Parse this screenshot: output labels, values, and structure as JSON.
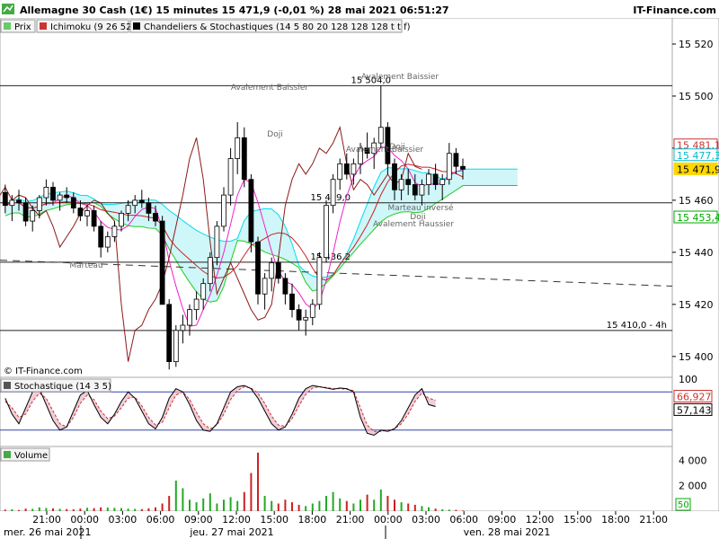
{
  "header": {
    "title": "Allemagne 30 Cash (1€) 15 minutes 15 471,9 (-0,01 %) 28 mai 2021 06:51:27",
    "brand": "IT-Finance.com"
  },
  "legend": [
    {
      "label": "Prix",
      "color": "#66cc66"
    },
    {
      "label": "Ichimoku (9 26 52)",
      "color": "#cc3333"
    },
    {
      "label": "Chandeliers & Stochastiques (14 5 80 20 128 128 128 t t f)",
      "color": "#000000"
    }
  ],
  "copyright": "© IT-Finance.com",
  "chart_data": [
    {
      "type": "candlestick",
      "ylim": [
        15392,
        15530
      ],
      "y_ticks": [
        "15 400",
        "15 420",
        "15 440",
        "15 460",
        "15 480",
        "15 500",
        "15 520"
      ],
      "price_tags": [
        {
          "value": 15481.1,
          "label": "15 481,1",
          "color": "#cc3333"
        },
        {
          "value": 15477.3,
          "label": "15 477,3",
          "color": "#00bbcc"
        },
        {
          "value": 15471.9,
          "label": "15 471,9",
          "color": "#ffd700"
        },
        {
          "value": 15453.4,
          "label": "15 453,4",
          "color": "#00aa00"
        }
      ],
      "levels": [
        {
          "value": 15504.0,
          "label": "15 504,0"
        },
        {
          "value": 15459.0,
          "label": "15 459,0"
        },
        {
          "value": 15436.2,
          "label": "15 436,2"
        },
        {
          "value": 15410.0,
          "label": "15 410,0 - 4h"
        }
      ],
      "annotations": [
        "Avalement Baissier",
        "Avalement Baissier",
        "Doji",
        "Avalement Baissier",
        "Doji",
        "Marteau",
        "Marteau inversé",
        "Avalement Haussier",
        "Doji"
      ],
      "candles_ohlc": [
        [
          15463,
          15466,
          15455,
          15458
        ],
        [
          15458,
          15462,
          15452,
          15460
        ],
        [
          15460,
          15464,
          15456,
          15459
        ],
        [
          15459,
          15461,
          15450,
          15452
        ],
        [
          15452,
          15458,
          15448,
          15456
        ],
        [
          15456,
          15462,
          15453,
          15461
        ],
        [
          15461,
          15468,
          15458,
          15465
        ],
        [
          15465,
          15467,
          15458,
          15460
        ],
        [
          15460,
          15463,
          15456,
          15462
        ],
        [
          15462,
          15465,
          15459,
          15461
        ],
        [
          15461,
          15463,
          15455,
          15457
        ],
        [
          15457,
          15460,
          15452,
          15454
        ],
        [
          15454,
          15458,
          15450,
          15456
        ],
        [
          15456,
          15458,
          15448,
          15450
        ],
        [
          15450,
          15452,
          15438,
          15442
        ],
        [
          15442,
          15448,
          15440,
          15446
        ],
        [
          15446,
          15452,
          15444,
          15450
        ],
        [
          15450,
          15456,
          15448,
          15455
        ],
        [
          15455,
          15460,
          15452,
          15458
        ],
        [
          15458,
          15462,
          15455,
          15460
        ],
        [
          15460,
          15464,
          15457,
          15459
        ],
        [
          15459,
          15461,
          15452,
          15455
        ],
        [
          15455,
          15458,
          15450,
          15452
        ],
        [
          15452,
          15454,
          15430,
          15420
        ],
        [
          15420,
          15422,
          15395,
          15398
        ],
        [
          15398,
          15412,
          15396,
          15410
        ],
        [
          15410,
          15416,
          15405,
          15412
        ],
        [
          15412,
          15420,
          15408,
          15418
        ],
        [
          15418,
          15425,
          15414,
          15422
        ],
        [
          15422,
          15430,
          15418,
          15428
        ],
        [
          15428,
          15440,
          15425,
          15438
        ],
        [
          15438,
          15452,
          15435,
          15450
        ],
        [
          15450,
          15465,
          15448,
          15462
        ],
        [
          15462,
          15480,
          15458,
          15476
        ],
        [
          15476,
          15490,
          15470,
          15484
        ],
        [
          15484,
          15488,
          15465,
          15468
        ],
        [
          15468,
          15470,
          15440,
          15444
        ],
        [
          15444,
          15446,
          15420,
          15424
        ],
        [
          15424,
          15432,
          15418,
          15430
        ],
        [
          15430,
          15438,
          15425,
          15436
        ],
        [
          15436,
          15438,
          15428,
          15430
        ],
        [
          15430,
          15432,
          15420,
          15424
        ],
        [
          15424,
          15428,
          15415,
          15418
        ],
        [
          15418,
          15420,
          15410,
          15414
        ],
        [
          15414,
          15418,
          15408,
          15415
        ],
        [
          15415,
          15422,
          15412,
          15420
        ],
        [
          15420,
          15440,
          15418,
          15438
        ],
        [
          15438,
          15460,
          15436,
          15458
        ],
        [
          15458,
          15470,
          15455,
          15468
        ],
        [
          15468,
          15476,
          15464,
          15474
        ],
        [
          15474,
          15478,
          15468,
          15470
        ],
        [
          15470,
          15476,
          15466,
          15474
        ],
        [
          15474,
          15482,
          15470,
          15480
        ],
        [
          15480,
          15486,
          15476,
          15478
        ],
        [
          15478,
          15484,
          15472,
          15482
        ],
        [
          15482,
          15504,
          15480,
          15488
        ],
        [
          15488,
          15490,
          15470,
          15474
        ],
        [
          15474,
          15476,
          15460,
          15464
        ],
        [
          15464,
          15470,
          15460,
          15468
        ],
        [
          15468,
          15472,
          15462,
          15466
        ],
        [
          15466,
          15470,
          15460,
          15462
        ],
        [
          15462,
          15468,
          15458,
          15466
        ],
        [
          15466,
          15472,
          15462,
          15470
        ],
        [
          15470,
          15474,
          15464,
          15466
        ],
        [
          15466,
          15470,
          15460,
          15468
        ],
        [
          15468,
          15482,
          15466,
          15478
        ],
        [
          15478,
          15480,
          15470,
          15473
        ],
        [
          15473,
          15476,
          15468,
          15471.9
        ]
      ]
    },
    {
      "type": "line",
      "title": "Stochastique (14 3 5)",
      "ylim": [
        0,
        100
      ],
      "y_ticks": [
        "100"
      ],
      "hlines": [
        80,
        20
      ],
      "price_tags": [
        {
          "value": 66.927,
          "label": "66,927",
          "color": "#cc3333"
        },
        {
          "value": 57.143,
          "label": "57,143",
          "color": "#000000"
        }
      ],
      "series_k": [
        70,
        45,
        30,
        55,
        80,
        85,
        60,
        35,
        20,
        25,
        50,
        75,
        82,
        60,
        40,
        30,
        45,
        65,
        80,
        70,
        50,
        30,
        22,
        40,
        70,
        85,
        80,
        60,
        35,
        20,
        18,
        30,
        55,
        80,
        88,
        90,
        85,
        70,
        50,
        30,
        20,
        25,
        45,
        70,
        85,
        90,
        88,
        86,
        84,
        86,
        85,
        80,
        40,
        15,
        12,
        20,
        18,
        22,
        35,
        55,
        75,
        85,
        60,
        57
      ],
      "series_d": [
        65,
        55,
        40,
        45,
        65,
        78,
        70,
        50,
        30,
        25,
        40,
        62,
        75,
        68,
        50,
        38,
        42,
        55,
        70,
        72,
        58,
        40,
        28,
        32,
        55,
        75,
        80,
        68,
        48,
        30,
        22,
        28,
        45,
        68,
        82,
        88,
        86,
        78,
        62,
        42,
        28,
        26,
        38,
        58,
        76,
        86,
        88,
        87,
        85,
        85,
        84,
        82,
        55,
        28,
        18,
        18,
        20,
        22,
        30,
        45,
        65,
        78,
        70,
        66.9
      ]
    },
    {
      "type": "bar",
      "title": "Volume",
      "ylim": [
        0,
        4800
      ],
      "y_ticks": [
        "2 000",
        "4 000"
      ],
      "price_tags": [
        {
          "value": 50,
          "label": "50",
          "color": "#00aa00"
        }
      ],
      "values": [
        120,
        150,
        90,
        200,
        180,
        300,
        250,
        220,
        180,
        160,
        140,
        200,
        260,
        240,
        300,
        280,
        260,
        240,
        200,
        180,
        160,
        220,
        300,
        600,
        1200,
        2400,
        1800,
        900,
        700,
        1000,
        1400,
        600,
        900,
        1100,
        800,
        1500,
        3000,
        4600,
        1200,
        800,
        600,
        900,
        700,
        500,
        400,
        600,
        800,
        1200,
        1500,
        1000,
        800,
        600,
        900,
        1300,
        900,
        1700,
        1200,
        900,
        700,
        600,
        500,
        400,
        300,
        200,
        150,
        120,
        100,
        50
      ]
    }
  ],
  "x_axis": {
    "ticks": [
      "21:00",
      "00:00",
      "03:00",
      "06:00",
      "09:00",
      "12:00",
      "15:00",
      "18:00",
      "21:00",
      "00:00",
      "03:00",
      "06:00",
      "09:00",
      "12:00",
      "15:00",
      "18:00",
      "21:00"
    ],
    "days": [
      "mer. 26 mai 2021",
      "jeu. 27 mai 2021",
      "ven. 28 mai 2021"
    ]
  }
}
